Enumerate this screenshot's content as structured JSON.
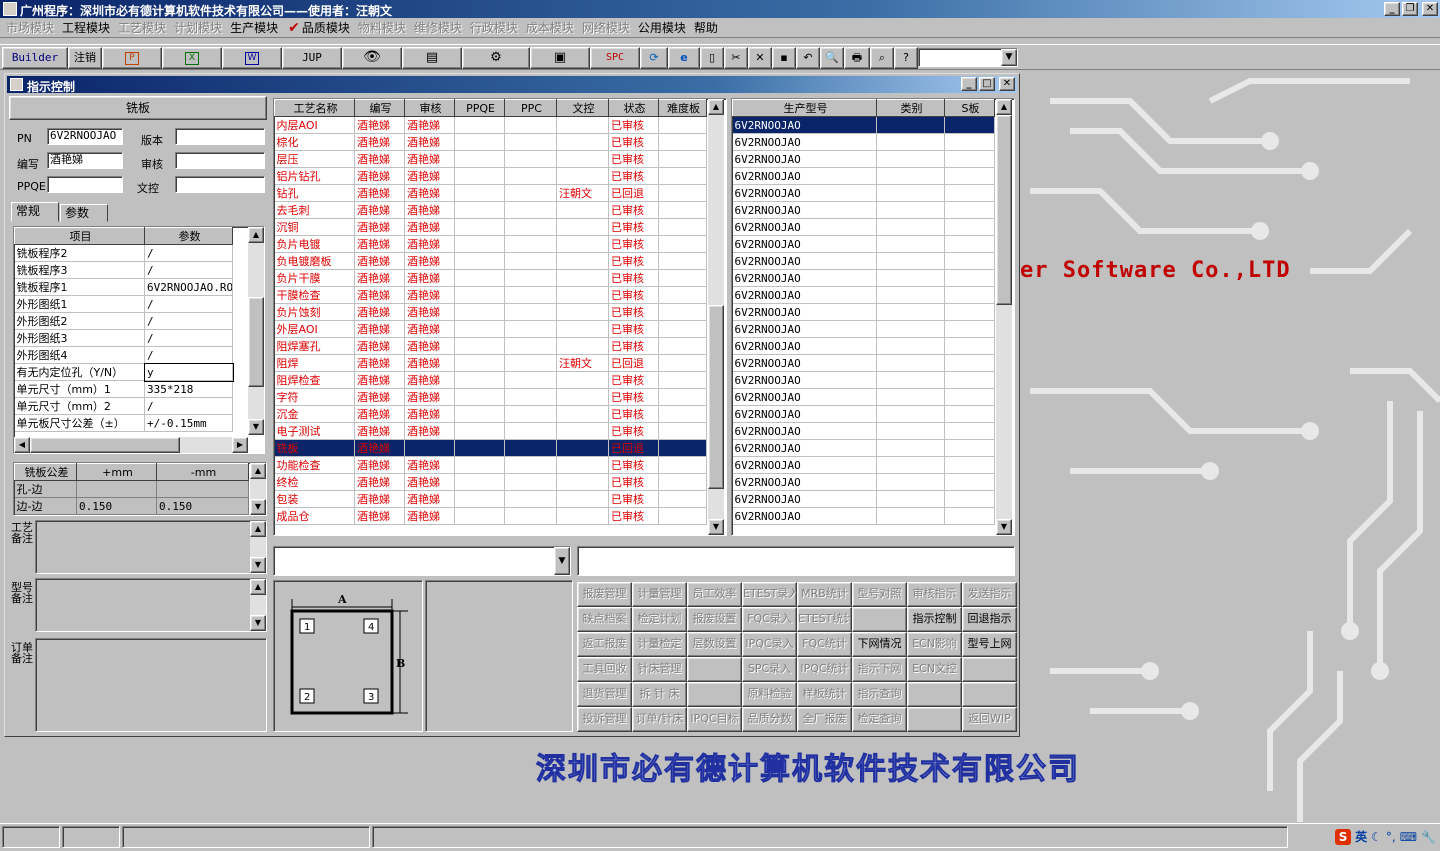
{
  "app": {
    "title": "广州程序：深圳市必有德计算机软件技术有限公司——使用者：汪朝文"
  },
  "menus": [
    {
      "label": "市场模块",
      "disabled": true
    },
    {
      "label": "工程模块",
      "disabled": false
    },
    {
      "label": "工艺模块",
      "disabled": true
    },
    {
      "label": "计划模块",
      "disabled": true
    },
    {
      "label": "生产模块",
      "disabled": false
    },
    {
      "label": "品质模块",
      "disabled": false
    },
    {
      "label": "物料模块",
      "disabled": true
    },
    {
      "label": "维修模块",
      "disabled": true
    },
    {
      "label": "行政模块",
      "disabled": true
    },
    {
      "label": "成本模块",
      "disabled": true
    },
    {
      "label": "网络模块",
      "disabled": true
    },
    {
      "label": "公用模块",
      "disabled": false
    },
    {
      "label": "帮助",
      "disabled": false
    }
  ],
  "toolbar": {
    "builder": "Builder",
    "logout": "注销",
    "jup": "JUP",
    "spc": "SPC"
  },
  "window": {
    "title": "指示控制"
  },
  "left": {
    "header": "铣板",
    "pn_label": "PN",
    "pn_value": "6V2RNOOJAO",
    "version_label": "版本",
    "version_value": "",
    "author_label": "编写",
    "author_value": "酒艳娣",
    "review_label": "审核",
    "review_value": "",
    "ppqe_label": "PPQE",
    "ppqe_value": "",
    "doc_label": "文控",
    "doc_value": "",
    "tabs": [
      "常规",
      "参数"
    ],
    "param_headers": [
      "项目",
      "参数"
    ],
    "params": [
      [
        "铣板程序2",
        "/"
      ],
      [
        "铣板程序3",
        "/"
      ],
      [
        "铣板程序1",
        "6V2RNOOJAO.ROU"
      ],
      [
        "外形图纸1",
        "/"
      ],
      [
        "外形图纸2",
        "/"
      ],
      [
        "外形图纸3",
        "/"
      ],
      [
        "外形图纸4",
        "/"
      ],
      [
        "有无内定位孔（Y/N）",
        "y"
      ],
      [
        "单元尺寸（mm）1",
        "335*218"
      ],
      [
        "单元尺寸（mm）2",
        "/"
      ],
      [
        "单元板尺寸公差（±）",
        "+/-0.15mm"
      ]
    ],
    "tol_headers": [
      "铣板公差",
      "+mm",
      "-mm"
    ],
    "tol_rows": [
      [
        "孔-边",
        "",
        ""
      ],
      [
        "边-边",
        "0.150",
        "0.150"
      ]
    ],
    "memo1": "工艺备注",
    "memo2": "型号备注",
    "memo3": "订单备注"
  },
  "process": {
    "headers": [
      "工艺名称",
      "编写",
      "审核",
      "PPQE",
      "PPC",
      "文控",
      "状态",
      "难度板"
    ],
    "rows": [
      [
        "内层AOI",
        "酒艳娣",
        "酒艳娣",
        "",
        "",
        "",
        "已审核",
        ""
      ],
      [
        "棕化",
        "酒艳娣",
        "酒艳娣",
        "",
        "",
        "",
        "已审核",
        ""
      ],
      [
        "层压",
        "酒艳娣",
        "酒艳娣",
        "",
        "",
        "",
        "已审核",
        ""
      ],
      [
        "铝片钻孔",
        "酒艳娣",
        "酒艳娣",
        "",
        "",
        "",
        "已审核",
        ""
      ],
      [
        "钻孔",
        "酒艳娣",
        "酒艳娣",
        "",
        "",
        "汪朝文",
        "已回退",
        ""
      ],
      [
        "去毛刺",
        "酒艳娣",
        "酒艳娣",
        "",
        "",
        "",
        "已审核",
        ""
      ],
      [
        "沉铜",
        "酒艳娣",
        "酒艳娣",
        "",
        "",
        "",
        "已审核",
        ""
      ],
      [
        "负片电镀",
        "酒艳娣",
        "酒艳娣",
        "",
        "",
        "",
        "已审核",
        ""
      ],
      [
        "负电镀磨板",
        "酒艳娣",
        "酒艳娣",
        "",
        "",
        "",
        "已审核",
        ""
      ],
      [
        "负片干膜",
        "酒艳娣",
        "酒艳娣",
        "",
        "",
        "",
        "已审核",
        ""
      ],
      [
        "干膜检查",
        "酒艳娣",
        "酒艳娣",
        "",
        "",
        "",
        "已审核",
        ""
      ],
      [
        "负片蚀刻",
        "酒艳娣",
        "酒艳娣",
        "",
        "",
        "",
        "已审核",
        ""
      ],
      [
        "外层AOI",
        "酒艳娣",
        "酒艳娣",
        "",
        "",
        "",
        "已审核",
        ""
      ],
      [
        "阻焊塞孔",
        "酒艳娣",
        "酒艳娣",
        "",
        "",
        "",
        "已审核",
        ""
      ],
      [
        "阻焊",
        "酒艳娣",
        "酒艳娣",
        "",
        "",
        "汪朝文",
        "已回退",
        ""
      ],
      [
        "阻焊检查",
        "酒艳娣",
        "酒艳娣",
        "",
        "",
        "",
        "已审核",
        ""
      ],
      [
        "字符",
        "酒艳娣",
        "酒艳娣",
        "",
        "",
        "",
        "已审核",
        ""
      ],
      [
        "沉金",
        "酒艳娣",
        "酒艳娣",
        "",
        "",
        "",
        "已审核",
        ""
      ],
      [
        "电子测试",
        "酒艳娣",
        "酒艳娣",
        "",
        "",
        "",
        "已审核",
        ""
      ],
      [
        "铣板",
        "酒艳娣",
        "",
        "",
        "",
        "",
        "已回退",
        ""
      ],
      [
        "功能检查",
        "酒艳娣",
        "酒艳娣",
        "",
        "",
        "",
        "已审核",
        ""
      ],
      [
        "终检",
        "酒艳娣",
        "酒艳娣",
        "",
        "",
        "",
        "已审核",
        ""
      ],
      [
        "包装",
        "酒艳娣",
        "酒艳娣",
        "",
        "",
        "",
        "已审核",
        ""
      ],
      [
        "成品仓",
        "酒艳娣",
        "酒艳娣",
        "",
        "",
        "",
        "已审核",
        ""
      ]
    ],
    "selected_index": 19
  },
  "models": {
    "headers": [
      "生产型号",
      "类别",
      "S板"
    ],
    "rows": [
      "6V2RNOOJAO",
      "6V2RNOOJAO",
      "6V2RNOOJAO",
      "6V2RNOOJAO",
      "6V2RNOOJAO",
      "6V2RNOOJAO",
      "6V2RNOOJAO",
      "6V2RNOOJAO",
      "6V2RNOOJAO",
      "6V2RNOOJAO",
      "6V2RNOOJAO",
      "6V2RNOOJAO",
      "6V2RNOOJAO",
      "6V2RNOOJAO",
      "6V2RNOOJAO",
      "6V2RNOOJAO",
      "6V2RNOOJAO",
      "6V2RNOOJAO",
      "6V2RNOOJAO",
      "6V2RNOOJAO",
      "6V2RNOOJAO",
      "6V2RNOOJAO",
      "6V2RNOOJAO",
      "6V2RNOOJAO"
    ]
  },
  "diagram": {
    "a": "A",
    "b": "B",
    "n1": "1",
    "n2": "2",
    "n3": "3",
    "n4": "4"
  },
  "buttons": [
    {
      "label": "报废管理",
      "enabled": false
    },
    {
      "label": "计量管理",
      "enabled": false
    },
    {
      "label": "员工效率",
      "enabled": false
    },
    {
      "label": "ETEST录入",
      "enabled": false
    },
    {
      "label": "MRB统计",
      "enabled": false
    },
    {
      "label": "型号对照",
      "enabled": false
    },
    {
      "label": "审核指示",
      "enabled": false
    },
    {
      "label": "发送指示",
      "enabled": false
    },
    {
      "label": "缺点档案",
      "enabled": false
    },
    {
      "label": "检定计划",
      "enabled": false
    },
    {
      "label": "报废设置",
      "enabled": false
    },
    {
      "label": "FQC录入",
      "enabled": false
    },
    {
      "label": "ETEST统计",
      "enabled": false
    },
    {
      "label": "",
      "enabled": false
    },
    {
      "label": "指示控制",
      "enabled": true
    },
    {
      "label": "回退指示",
      "enabled": true
    },
    {
      "label": "返工报废",
      "enabled": false
    },
    {
      "label": "计量检定",
      "enabled": false
    },
    {
      "label": "层数设置",
      "enabled": false
    },
    {
      "label": "IPQC录入",
      "enabled": false
    },
    {
      "label": "FQC统计",
      "enabled": false
    },
    {
      "label": "下网情况",
      "enabled": true
    },
    {
      "label": "ECN影响",
      "enabled": false
    },
    {
      "label": "型号上网",
      "enabled": true
    },
    {
      "label": "工具回收",
      "enabled": false
    },
    {
      "label": "针床管理",
      "enabled": false
    },
    {
      "label": "",
      "enabled": false
    },
    {
      "label": "SPC录入",
      "enabled": false
    },
    {
      "label": "IPQC统计",
      "enabled": false
    },
    {
      "label": "指示下网",
      "enabled": false
    },
    {
      "label": "ECN文控",
      "enabled": false
    },
    {
      "label": "",
      "enabled": false
    },
    {
      "label": "退货管理",
      "enabled": false
    },
    {
      "label": "拆 针 床",
      "enabled": false
    },
    {
      "label": "",
      "enabled": false
    },
    {
      "label": "原料检验",
      "enabled": false
    },
    {
      "label": "样板统计",
      "enabled": false
    },
    {
      "label": "指示查询",
      "enabled": false
    },
    {
      "label": "",
      "enabled": false
    },
    {
      "label": "",
      "enabled": false
    },
    {
      "label": "投诉管理",
      "enabled": false
    },
    {
      "label": "订单/针床",
      "enabled": false
    },
    {
      "label": "IPQC目标",
      "enabled": false
    },
    {
      "label": "品质分数",
      "enabled": false
    },
    {
      "label": "全厂报废",
      "enabled": false
    },
    {
      "label": "检定查询",
      "enabled": false
    },
    {
      "label": "",
      "enabled": false
    },
    {
      "label": "返回WIP",
      "enabled": false
    }
  ],
  "background": {
    "brand_en": "er Software Co.,LTD",
    "brand_cn": "深圳市必有德计算机软件技术有限公司"
  },
  "ime": {
    "lang": "英"
  }
}
